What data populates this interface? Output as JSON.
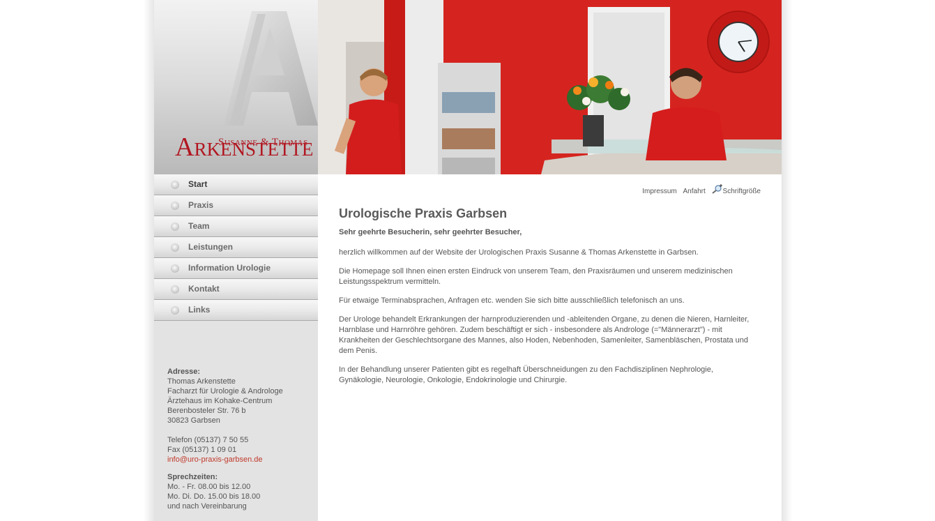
{
  "logo": {
    "line1": "Susanne & Thomas",
    "line2": "Arkenstette",
    "letter": "A"
  },
  "nav": [
    {
      "label": "Start",
      "active": true
    },
    {
      "label": "Praxis"
    },
    {
      "label": "Team"
    },
    {
      "label": "Leistungen"
    },
    {
      "label": "Information Urologie"
    },
    {
      "label": "Kontakt"
    },
    {
      "label": "Links"
    }
  ],
  "toplinks": {
    "impressum": "Impressum",
    "anfahrt": "Anfahrt",
    "schrift": "Schriftgröße",
    "schrift_icon": "zoom-in-icon"
  },
  "content": {
    "title": "Urologische Praxis Garbsen",
    "greeting": "Sehr geehrte Besucherin, sehr geehrter Besucher,",
    "paragraphs": [
      "herzlich willkommen auf der Website der Urologischen Praxis Susanne & Thomas Arkenstette in Garbsen.",
      "Die Homepage soll Ihnen einen ersten Eindruck von unserem Team, den Praxisräumen und unserem medizinischen Leistungsspektrum vermitteln.",
      "Für etwaige Terminabsprachen, Anfragen etc. wenden Sie sich bitte ausschließlich telefonisch an uns.",
      "Der Urologe behandelt Erkrankungen der harnproduzierenden und -ableitenden Organe, zu denen die Nieren, Harnleiter, Harnblase und Harnröhre gehören. Zudem beschäftigt er sich - insbesondere als Androloge (=\"Männerarzt\") - mit Krankheiten der Geschlechtsorgane des Mannes, also Hoden, Nebenhoden, Samenleiter, Samenbläschen, Prostata und dem Penis.",
      "In der Behandlung unserer Patienten gibt es regelhaft Überschneidungen zu den Fachdisziplinen Nephrologie, Gynäkologie, Neurologie, Onkologie, Endokrinologie und Chirurgie."
    ]
  },
  "address": {
    "label": "Adresse:",
    "lines": [
      "Thomas Arkenstette",
      "Facharzt für Urologie & Androloge",
      "Ärztehaus im Kohake-Centrum",
      "Berenbosteler Str. 76 b",
      "30823 Garbsen"
    ],
    "phone": "Telefon (05137) 7 50 55",
    "fax": "Fax (05137) 1 09 01",
    "email": "info@uro-praxis-garbsen.de",
    "hours_label": "Sprechzeiten:",
    "hours": [
      "Mo. - Fr. 08.00 bis 12.00",
      "Mo. Di. Do. 15.00 bis 18.00",
      "und nach Vereinbarung"
    ]
  },
  "colors": {
    "brand_red": "#b11721",
    "link_red": "#c0392b",
    "wall_red": "#d4201c"
  }
}
